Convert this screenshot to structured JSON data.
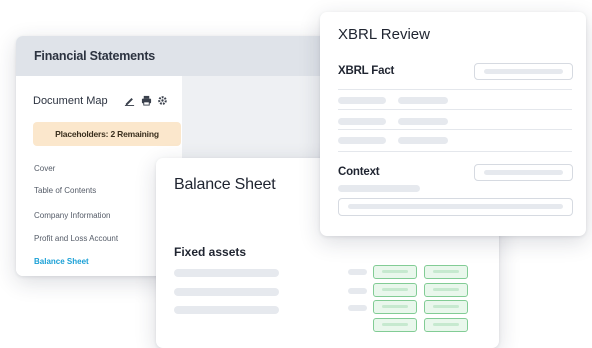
{
  "financial_statements": {
    "title": "Financial Statements",
    "document_map": {
      "label": "Document Map",
      "tools": [
        "edit-icon",
        "print-icon",
        "settings-icon"
      ]
    },
    "placeholders_badge": "Placeholders: 2 Remaining",
    "nav_items": [
      "Cover",
      "Table of Contents",
      "Company Information",
      "Profit and Loss Account",
      "Balance Sheet"
    ],
    "active_nav_item": "Balance Sheet"
  },
  "balance_sheet": {
    "title": "Balance Sheet",
    "section": "Fixed assets"
  },
  "xbrl_review": {
    "title": "XBRL Review",
    "fact_label": "XBRL Fact",
    "context_label": "Context"
  },
  "colors": {
    "accent": "#1aa0d6",
    "badge_bg": "#fbe7cc",
    "cell_border": "#82cc95",
    "titlebar_bg": "#dfe3e9"
  }
}
